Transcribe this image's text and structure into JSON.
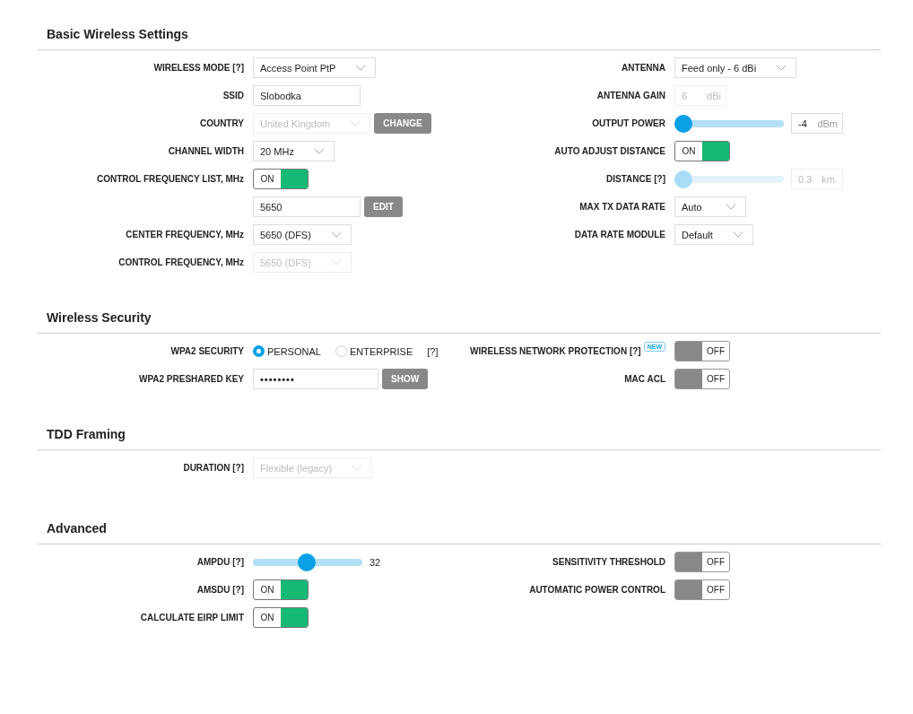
{
  "sections": [
    {
      "title": "Basic Wireless Settings",
      "left": [
        {
          "label": "WIRELESS MODE [?]",
          "controls": [
            {
              "kind": "select",
              "value": "Access Point PtP",
              "disabled": false
            }
          ]
        },
        {
          "label": "SSID",
          "controls": [
            {
              "kind": "input",
              "value": "Slobodka"
            }
          ]
        },
        {
          "label": "COUNTRY",
          "controls": [
            {
              "kind": "select",
              "value": "United Kingdom",
              "disabled": true
            },
            {
              "kind": "button",
              "label": "CHANGE"
            }
          ]
        },
        {
          "label": "CHANNEL WIDTH",
          "controls": [
            {
              "kind": "select",
              "value": "20 MHz",
              "disabled": false
            }
          ]
        },
        {
          "label": "CONTROL FREQUENCY LIST, MHz",
          "controls": [
            {
              "kind": "toggle",
              "on": true,
              "text": "ON"
            }
          ]
        },
        {
          "controls": [
            {
              "kind": "input",
              "value": "5650"
            },
            {
              "kind": "button",
              "label": "EDIT"
            }
          ]
        },
        {
          "label": "CENTER FREQUENCY, MHz",
          "controls": [
            {
              "kind": "select",
              "value": "5650 (DFS)",
              "disabled": false
            }
          ]
        },
        {
          "label": "CONTROL FREQUENCY, MHz",
          "controls": [
            {
              "kind": "select",
              "value": "5650 (DFS)",
              "disabled": true
            }
          ]
        }
      ],
      "right": [
        {
          "label": "ANTENNA",
          "controls": [
            {
              "kind": "select",
              "value": "Feed only - 6 dBi",
              "disabled": false
            }
          ]
        },
        {
          "label": "ANTENNA GAIN",
          "controls": [
            {
              "kind": "unit_field",
              "value": "6",
              "unit": "dBi",
              "disabled": true
            }
          ]
        },
        {
          "label": "OUTPUT POWER",
          "controls": [
            {
              "kind": "slider",
              "level": 0.0,
              "disabled": false
            },
            {
              "kind": "unit_field",
              "value": "-4",
              "unit": "dBm",
              "disabled": false
            }
          ]
        },
        {
          "label": "AUTO ADJUST DISTANCE",
          "controls": [
            {
              "kind": "toggle",
              "on": true,
              "text": "ON"
            }
          ]
        },
        {
          "label": "DISTANCE [?]",
          "controls": [
            {
              "kind": "slider",
              "level": 0.0,
              "disabled": true
            },
            {
              "kind": "unit_field",
              "value": "0.3",
              "unit": "km.",
              "disabled": true
            }
          ]
        },
        {
          "label": "MAX TX DATA RATE",
          "controls": [
            {
              "kind": "select",
              "value": "Auto",
              "disabled": false
            }
          ]
        },
        {
          "label": "DATA RATE MODULE",
          "controls": [
            {
              "kind": "select",
              "value": "Default",
              "disabled": false
            }
          ]
        }
      ]
    },
    {
      "title": "Wireless Security",
      "left": [
        {
          "label": "WPA2 SECURITY",
          "controls": [
            {
              "kind": "radio",
              "label": "PERSONAL",
              "selected": true
            },
            {
              "kind": "radio",
              "label": "ENTERPRISE",
              "selected": false
            },
            {
              "kind": "help",
              "text": "[?]"
            }
          ]
        },
        {
          "label": "WPA2 PRESHARED KEY",
          "controls": [
            {
              "kind": "password",
              "value": "••••••••"
            },
            {
              "kind": "button",
              "label": "SHOW"
            }
          ]
        }
      ],
      "right": [
        {
          "label": "WIRELESS NETWORK PROTECTION [?]",
          "badge": "NEW",
          "controls": [
            {
              "kind": "toggle",
              "on": false,
              "text": "OFF"
            }
          ]
        },
        {
          "label": "MAC ACL",
          "controls": [
            {
              "kind": "toggle",
              "on": false,
              "text": "OFF"
            }
          ]
        }
      ]
    },
    {
      "title": "TDD Framing",
      "left": [
        {
          "label": "DURATION [?]",
          "controls": [
            {
              "kind": "select",
              "value": "Flexible (legacy)",
              "disabled": true
            }
          ]
        }
      ]
    },
    {
      "title": "Advanced",
      "left": [
        {
          "label": "AMPDU [?]",
          "controls": [
            {
              "kind": "slider",
              "level": 0.5,
              "disabled": false
            },
            {
              "kind": "value",
              "text": "32"
            }
          ]
        },
        {
          "label": "AMSDU [?]",
          "controls": [
            {
              "kind": "toggle",
              "on": true,
              "text": "ON"
            }
          ]
        },
        {
          "label": "CALCULATE EIRP LIMIT",
          "controls": [
            {
              "kind": "toggle",
              "on": true,
              "text": "ON"
            }
          ]
        }
      ],
      "right": [
        {
          "label": "SENSITIVITY THRESHOLD",
          "controls": [
            {
              "kind": "toggle",
              "on": false,
              "text": "OFF"
            }
          ]
        },
        {
          "label": "AUTOMATIC POWER CONTROL",
          "controls": [
            {
              "kind": "toggle",
              "on": false,
              "text": "OFF"
            }
          ]
        }
      ]
    }
  ]
}
